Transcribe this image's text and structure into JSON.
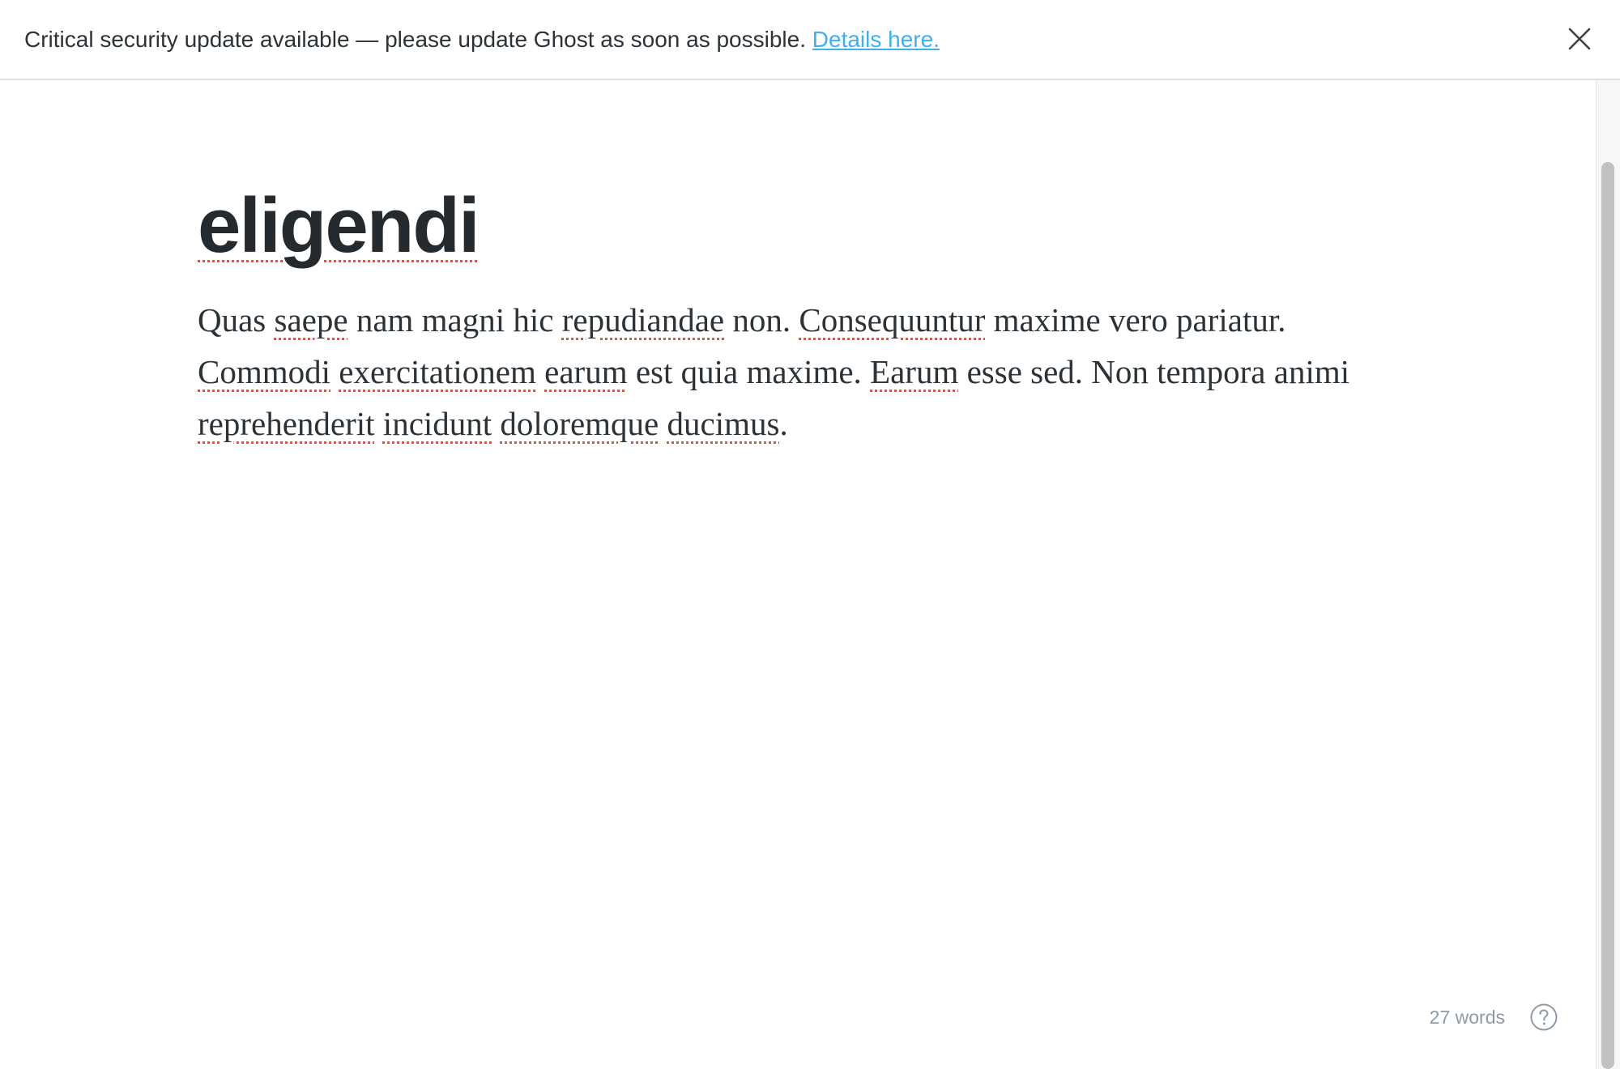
{
  "banner": {
    "message": "Critical security update available — please update Ghost as soon as possible.",
    "link_text": "Details here.",
    "close_icon": "close-icon"
  },
  "editor": {
    "title": "eligendi",
    "body_segments": [
      {
        "text": "Quas ",
        "spell": false
      },
      {
        "text": "saepe",
        "spell": true
      },
      {
        "text": " nam magni hic ",
        "spell": false
      },
      {
        "text": "repudiandae",
        "spell": true
      },
      {
        "text": " non. ",
        "spell": false
      },
      {
        "text": "Consequuntur",
        "spell": true
      },
      {
        "text": " maxime vero pariatur. ",
        "spell": false
      },
      {
        "text": "Commodi",
        "spell": true
      },
      {
        "text": " ",
        "spell": false
      },
      {
        "text": "exercitationem",
        "spell": true
      },
      {
        "text": " ",
        "spell": false
      },
      {
        "text": "earum",
        "spell": true
      },
      {
        "text": " est quia maxime. ",
        "spell": false
      },
      {
        "text": "Earum",
        "spell": true
      },
      {
        "text": " esse sed. Non tempora animi ",
        "spell": false
      },
      {
        "text": "reprehenderit",
        "spell": true
      },
      {
        "text": " ",
        "spell": false
      },
      {
        "text": "incidunt",
        "spell": true
      },
      {
        "text": " ",
        "spell": false
      },
      {
        "text": "doloremque",
        "spell": true
      },
      {
        "text": " ",
        "spell": false
      },
      {
        "text": "ducimus",
        "spell": true
      },
      {
        "text": ".",
        "spell": false
      }
    ]
  },
  "footer": {
    "word_count": "27 words",
    "help_icon": "help-circle-icon"
  },
  "colors": {
    "link": "#3eb0ef",
    "spellcheck": "#e25440",
    "text": "#2b3338",
    "muted": "#8e9aa3"
  }
}
